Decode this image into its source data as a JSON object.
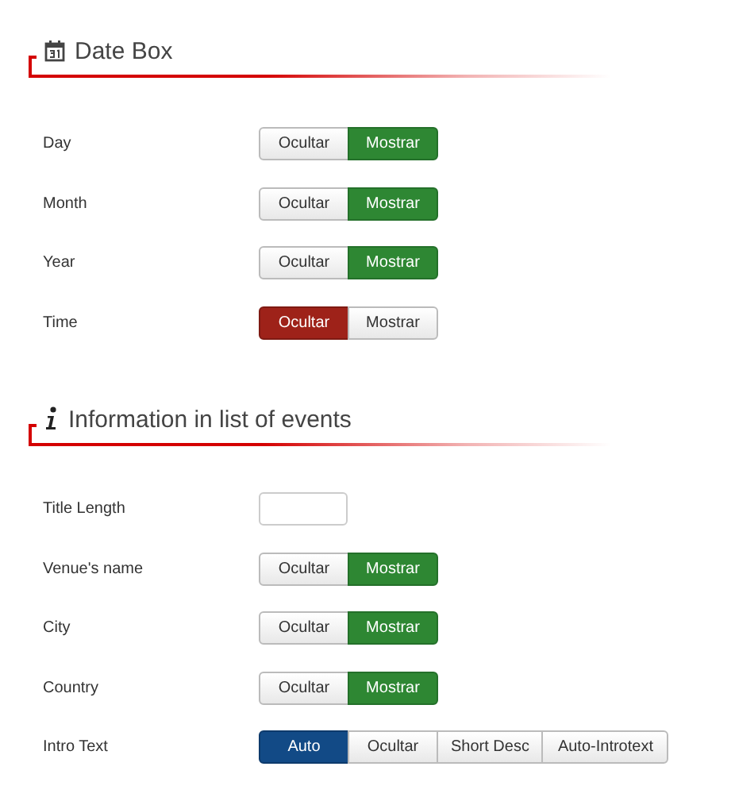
{
  "sections": [
    {
      "title": "Date Box",
      "kind": "calendar",
      "rows": [
        {
          "label": "Day",
          "kind": "toggle",
          "options": [
            {
              "label": "Ocultar",
              "kind": "hide",
              "selected": false
            },
            {
              "label": "Mostrar",
              "kind": "show",
              "selected": true
            }
          ]
        },
        {
          "label": "Month",
          "kind": "toggle",
          "options": [
            {
              "label": "Ocultar",
              "kind": "hide",
              "selected": false
            },
            {
              "label": "Mostrar",
              "kind": "show",
              "selected": true
            }
          ]
        },
        {
          "label": "Year",
          "kind": "toggle",
          "options": [
            {
              "label": "Ocultar",
              "kind": "hide",
              "selected": false
            },
            {
              "label": "Mostrar",
              "kind": "show",
              "selected": true
            }
          ]
        },
        {
          "label": "Time",
          "kind": "toggle",
          "options": [
            {
              "label": "Ocultar",
              "kind": "hide",
              "selected": true
            },
            {
              "label": "Mostrar",
              "kind": "show",
              "selected": false
            }
          ]
        }
      ]
    },
    {
      "title": "Information in list of events",
      "kind": "info",
      "rows": [
        {
          "label": "Title Length",
          "kind": "input"
        },
        {
          "label": "Venue's name",
          "kind": "toggle",
          "options": [
            {
              "label": "Ocultar",
              "kind": "hide",
              "selected": false
            },
            {
              "label": "Mostrar",
              "kind": "show",
              "selected": true
            }
          ]
        },
        {
          "label": "City",
          "kind": "toggle",
          "options": [
            {
              "label": "Ocultar",
              "kind": "hide",
              "selected": false
            },
            {
              "label": "Mostrar",
              "kind": "show",
              "selected": true
            }
          ]
        },
        {
          "label": "Country",
          "kind": "toggle",
          "options": [
            {
              "label": "Ocultar",
              "kind": "hide",
              "selected": false
            },
            {
              "label": "Mostrar",
              "kind": "show",
              "selected": true
            }
          ]
        },
        {
          "label": "Intro Text",
          "kind": "toggle",
          "options": [
            {
              "label": "Auto",
              "kind": "auto",
              "selected": true
            },
            {
              "label": "Ocultar",
              "kind": "hide",
              "selected": false
            },
            {
              "label": "Short Desc",
              "kind": "other",
              "selected": false
            },
            {
              "label": "Auto-Introtext",
              "kind": "other",
              "selected": false
            }
          ]
        }
      ]
    }
  ]
}
